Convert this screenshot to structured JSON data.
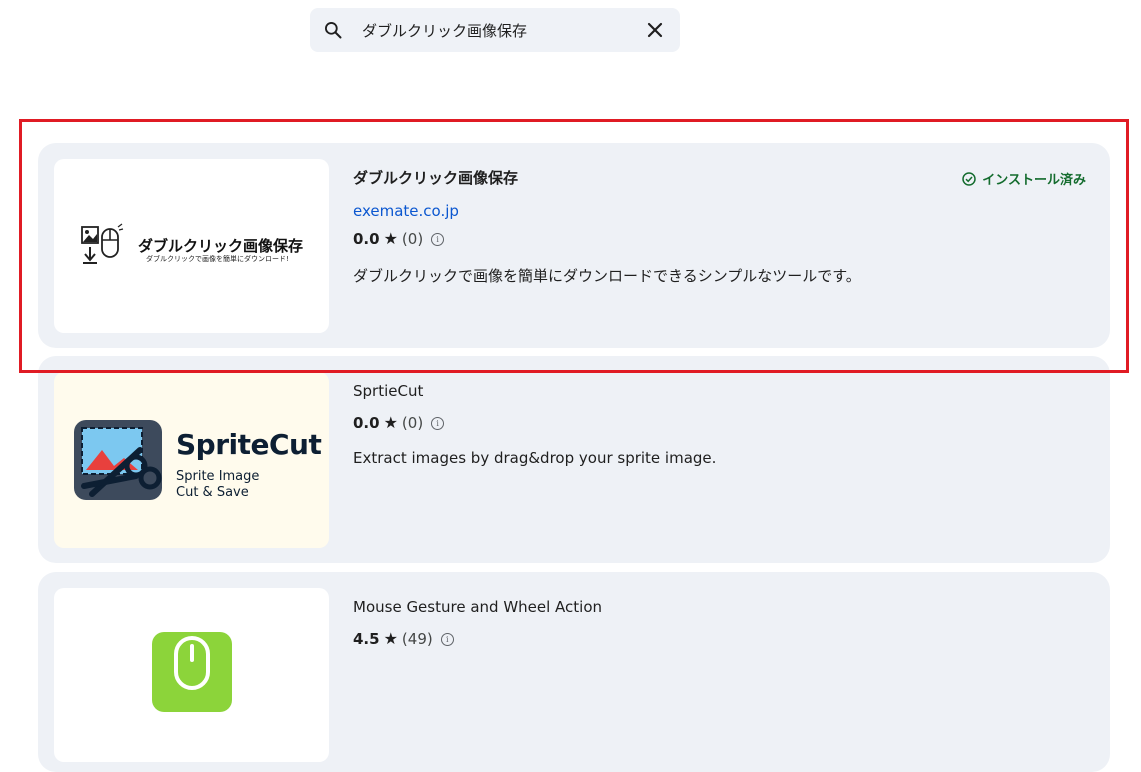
{
  "search": {
    "query": "ダブルクリック画像保存"
  },
  "results": [
    {
      "title": "ダブルクリック画像保存",
      "developer": "exemate.co.jp",
      "score": "0.0",
      "count": "(0)",
      "description": "ダブルクリックで画像を簡単にダウンロードできるシンプルなツールです。",
      "status": "インストール済み",
      "thumb_title": "ダブルクリック画像保存",
      "thumb_sub": "ダブルクリックで画像を簡単にダウンロード!"
    },
    {
      "title": "SprtieCut",
      "score": "0.0",
      "count": "(0)",
      "description": "Extract images by drag&drop your sprite image.",
      "thumb_title": "SpriteCut",
      "thumb_line1": "Sprite Image",
      "thumb_line2": "Cut & Save"
    },
    {
      "title": "Mouse Gesture and Wheel Action",
      "score": "4.5",
      "count": "(49)"
    }
  ],
  "icons": {
    "search": "search-icon",
    "close": "close-icon",
    "star": "star-icon",
    "info": "info-icon",
    "check": "check-circle-icon"
  },
  "colors": {
    "highlight": "#e01b24",
    "installed": "#146c2e",
    "link": "#0b57d0",
    "card": "#eef1f6"
  }
}
